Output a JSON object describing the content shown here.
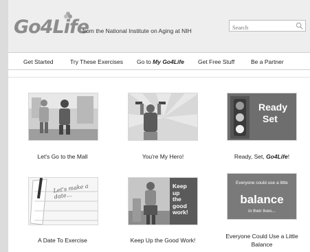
{
  "header": {
    "logo": "Go4Life",
    "tagline": "from the National Institute on Aging at NIH",
    "search_placeholder": "Search"
  },
  "nav": {
    "items": [
      {
        "label": "Get Started"
      },
      {
        "label": "Try These Exercises"
      },
      {
        "prefix": "Go to ",
        "label_emphasis": "My Go4Life"
      },
      {
        "label": "Get Free Stuff"
      },
      {
        "label": "Be a Partner"
      }
    ]
  },
  "cards": [
    {
      "caption": "Let's Go to the Mall"
    },
    {
      "caption": "You're My Hero!"
    },
    {
      "caption_prefix": "Ready, Set, ",
      "caption_emphasis": "Go4Life",
      "caption_suffix": "!"
    },
    {
      "caption": "A Date To Exercise",
      "image_text": "Let's make a date..."
    },
    {
      "caption": "Keep Up the Good Work!",
      "image_text": [
        "Keep",
        "up",
        "the",
        "good",
        "work!"
      ]
    },
    {
      "caption": "Everyone Could Use a Little Balance",
      "image_text": {
        "top": "Everyone could use a little",
        "big": "balance",
        "bottom": "in their lives..."
      }
    }
  ],
  "thumb_text": {
    "ready": "Ready",
    "set": "Set"
  },
  "colors": {
    "background": "#dcdcdc",
    "header": "#eeeeee",
    "logo": "#8c8c8c",
    "card_dark": "#6b6b6b"
  }
}
